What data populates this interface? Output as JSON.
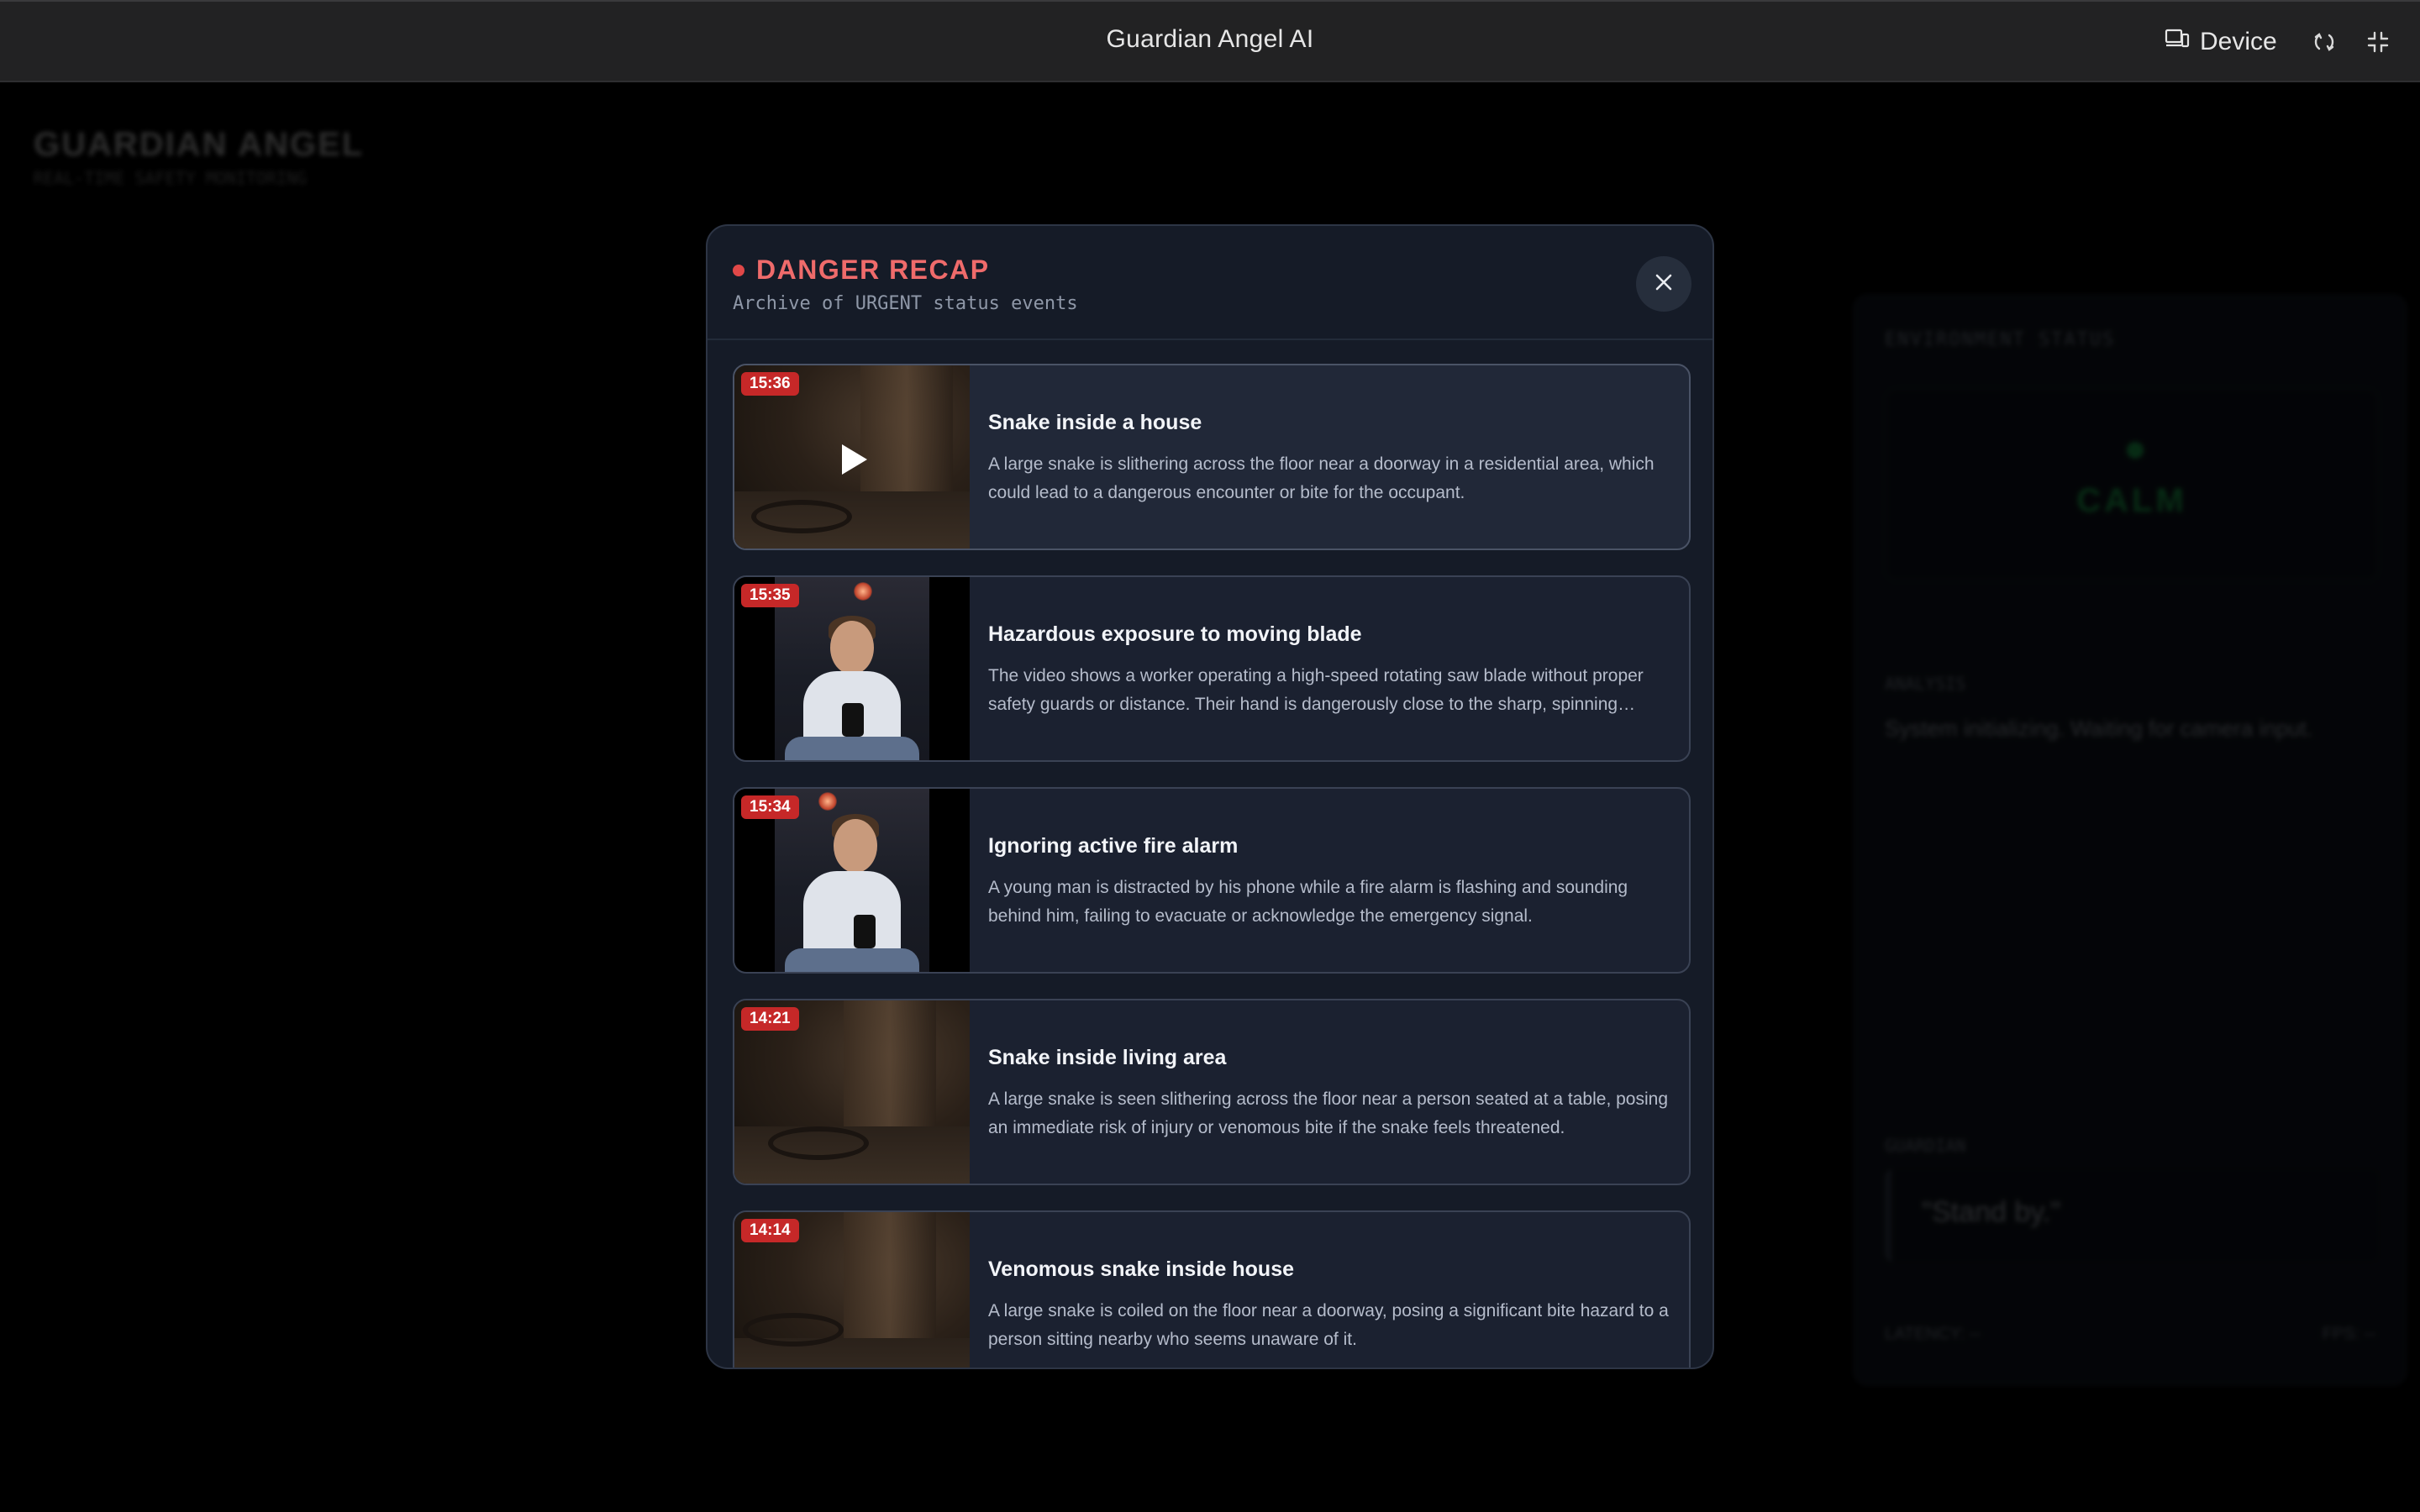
{
  "topbar": {
    "title": "Guardian Angel AI",
    "device_label": "Device"
  },
  "background": {
    "brand": "GUARDIAN ANGEL",
    "subtitle": "REAL-TIME SAFETY MONITORING",
    "panel_label": "ENVIRONMENT STATUS",
    "state": "CALM",
    "analysis_label": "ANALYSIS",
    "analysis_text": "System initializing. Waiting for camera input.",
    "voice_label": "GUARDIAN",
    "voice_quote": "\"Stand by.\"",
    "footer_left": "LATENCY: --",
    "footer_right": "FPS: --"
  },
  "modal": {
    "title": "DANGER RECAP",
    "subtitle": "Archive of URGENT status events",
    "events": [
      {
        "time": "15:36",
        "title": "Snake inside a house",
        "description": "A large snake is slithering across the floor near a doorway in a residential area, which could lead to a dangerous encounter or bite for the occupant."
      },
      {
        "time": "15:35",
        "title": "Hazardous exposure to moving blade",
        "description": "The video shows a worker operating a high-speed rotating saw blade without proper safety guards or distance. Their hand is dangerously close to the sharp, spinning blade."
      },
      {
        "time": "15:34",
        "title": "Ignoring active fire alarm",
        "description": "A young man is distracted by his phone while a fire alarm is flashing and sounding behind him, failing to evacuate or acknowledge the emergency signal."
      },
      {
        "time": "14:21",
        "title": "Snake inside living area",
        "description": "A large snake is seen slithering across the floor near a person seated at a table, posing an immediate risk of injury or venomous bite if the snake feels threatened."
      },
      {
        "time": "14:14",
        "title": "Venomous snake inside house",
        "description": "A large snake is coiled on the floor near a doorway, posing a significant bite hazard to a person sitting nearby who seems unaware of it."
      }
    ]
  },
  "colors": {
    "accent_danger": "#ef6b6b",
    "timestamp_badge": "#c62828",
    "calm_green": "#22c55e"
  },
  "icons": {
    "device": "device-icon",
    "refresh": "refresh-icon",
    "fullscreen": "exit-fullscreen-icon",
    "close": "close-icon",
    "play": "play-icon"
  }
}
